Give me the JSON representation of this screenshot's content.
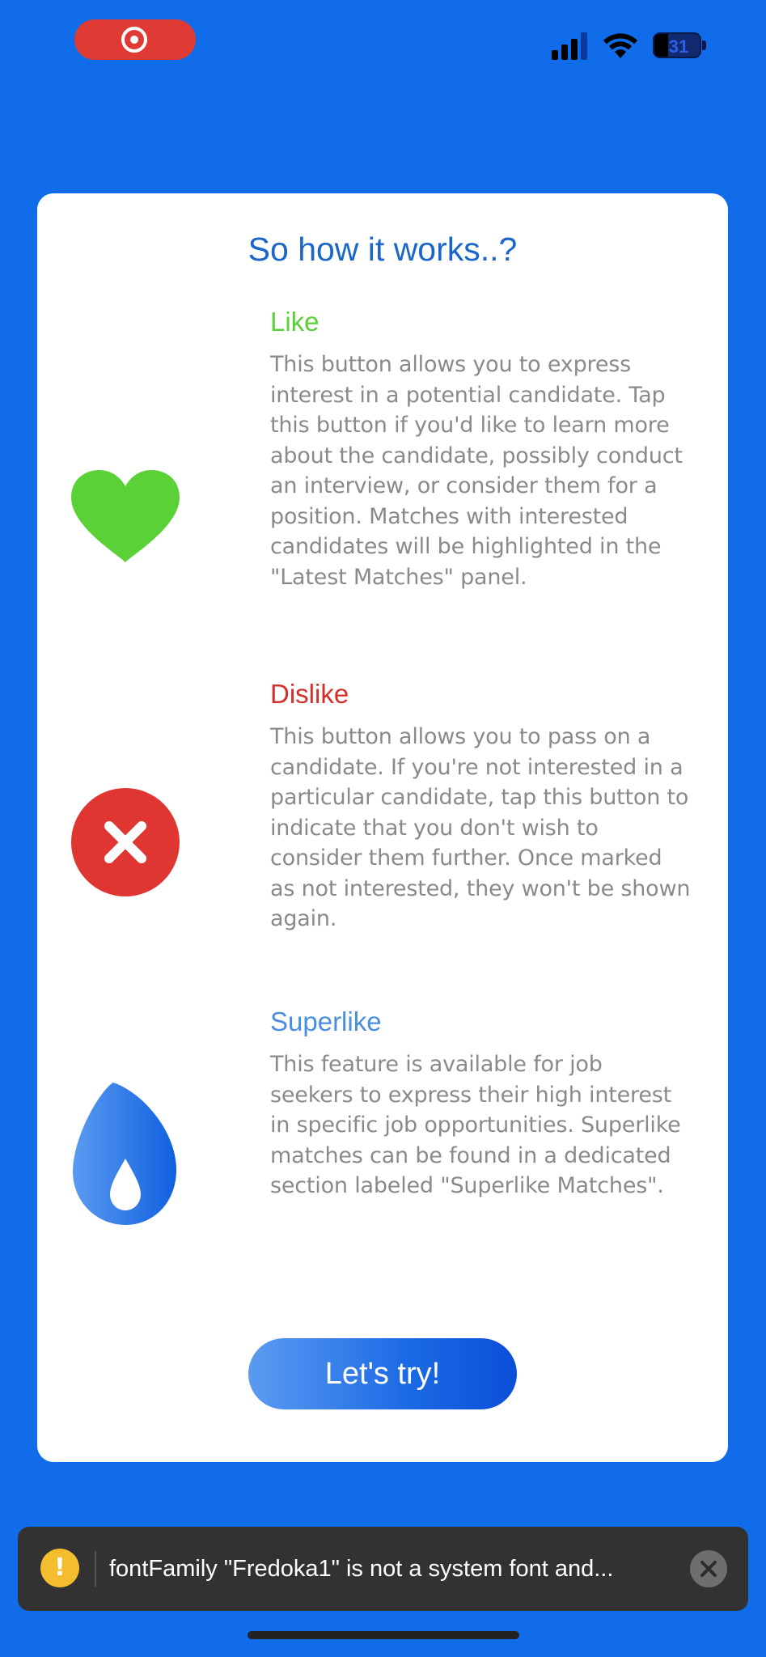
{
  "status_bar": {
    "battery_level": "31",
    "battery_fraction": 0.31,
    "recording_indicator": "screen-recording-icon"
  },
  "card": {
    "title": "So how it works..?",
    "sections": [
      {
        "heading": "Like",
        "heading_color": "#5ad136",
        "icon": "heart-icon",
        "icon_color": "#5ad136",
        "body": "This button allows you to express interest in a potential candidate. Tap this button if you'd like to learn more about the candidate, possibly conduct an interview, or consider them for a position. Matches with interested candidates will be highlighted in the \"Latest Matches\" panel."
      },
      {
        "heading": "Dislike",
        "heading_color": "#d2302b",
        "icon": "close-icon",
        "icon_color": "#df3632",
        "body": "This button allows you to pass on a candidate. If you're not interested in a particular candidate, tap this button to indicate that you don't wish to consider them further. Once marked as not interested, they won't be shown again."
      },
      {
        "heading": "Superlike",
        "heading_color": "#4a8ee0",
        "icon": "flame-icon",
        "icon_color": "#1e6ee6",
        "body": "This feature is available for job seekers to express their high interest in specific job opportunities. Superlike matches can be found in a dedicated section labeled \"Superlike Matches\"."
      }
    ],
    "button_label": "Let's try!"
  },
  "toast": {
    "message": "fontFamily \"Fredoka1\" is not a system font and...",
    "icon": "warning-icon",
    "warning_glyph": "!"
  },
  "colors": {
    "background": "#116cea",
    "card": "#ffffff",
    "title": "#1a66c9",
    "body_text": "#8a8a8a"
  }
}
